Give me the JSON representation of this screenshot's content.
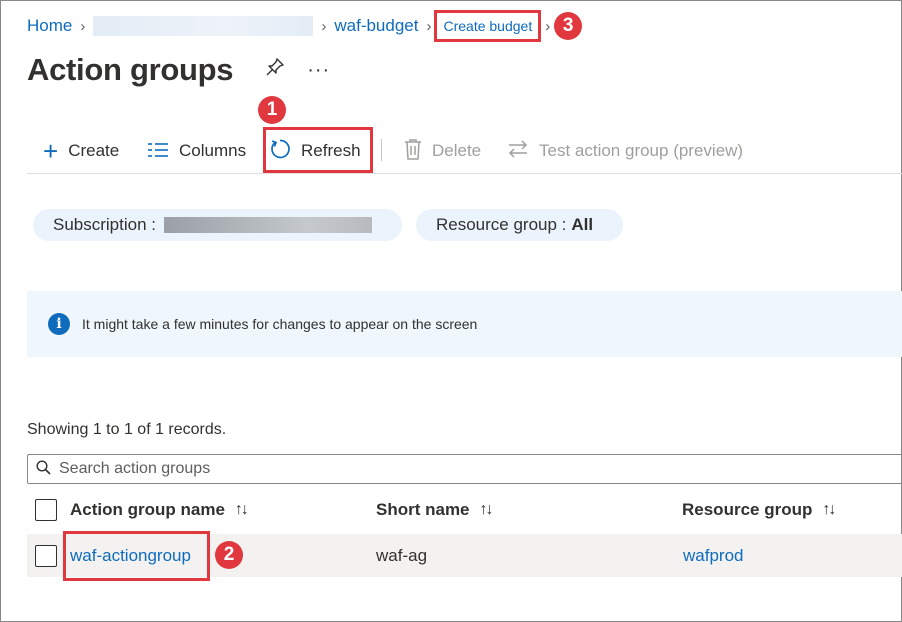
{
  "breadcrumb": {
    "home": "Home",
    "parent": "waf-budget",
    "current": "Create budget"
  },
  "page": {
    "title": "Action groups"
  },
  "toolbar": {
    "create": "Create",
    "columns": "Columns",
    "refresh": "Refresh",
    "delete": "Delete",
    "test": "Test action group (preview)"
  },
  "filters": {
    "subscription_label": "Subscription :",
    "resource_group_label": "Resource group :",
    "resource_group_value": "All"
  },
  "info": {
    "message": "It might take a few minutes for changes to appear on the screen"
  },
  "records": "Showing 1 to 1 of 1 records.",
  "search": {
    "placeholder": "Search action groups"
  },
  "table": {
    "columns": [
      "Action group name",
      "Short name",
      "Resource group"
    ],
    "rows": [
      {
        "name": "waf-actiongroup",
        "short_name": "waf-ag",
        "resource_group": "wafprod"
      }
    ]
  },
  "annotations": [
    "1",
    "2",
    "3"
  ],
  "colors": {
    "accent": "#0f6cbd",
    "highlight": "#e0383e",
    "banner": "#eff6fc"
  }
}
